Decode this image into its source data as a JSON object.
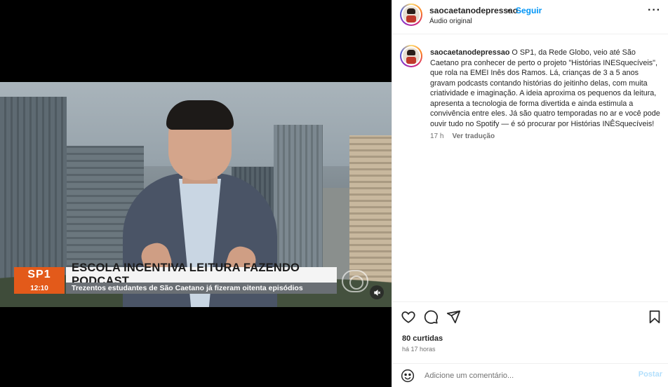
{
  "post": {
    "username": "saocaetanodepressao",
    "follow_label": "Seguir",
    "separator": "•",
    "audio_label": "Áudio original",
    "more_label": "···"
  },
  "video": {
    "logo_top": "SP1",
    "logo_time": "12:10",
    "headline": "ESCOLA INCENTIVA LEITURA FAZENDO PODCAST",
    "subline": "Trezentos estudantes de São Caetano já fizeram oitenta episódios",
    "mute_icon": "speaker-muted-icon"
  },
  "caption": {
    "username": "saocaetanodepressao",
    "text": "O SP1, da Rede Globo, veio até São Caetano pra conhecer de perto o projeto \"Histórias INESquecíveis\", que rola na EMEI Inês dos Ramos. Lá, crianças de 3 a 5 anos gravam podcasts contando histórias do jeitinho delas, com muita criatividade e imaginação. A ideia aproxima os pequenos da leitura, apresenta a tecnologia de forma divertida e ainda estimula a convivência entre eles. Já são quatro temporadas no ar e você pode ouvir tudo no Spotify — é só procurar por Histórias INÊSquecíveis!",
    "age": "17 h",
    "translate_label": "Ver tradução"
  },
  "actions": {
    "icons": [
      "heart-icon",
      "comment-icon",
      "share-icon",
      "bookmark-icon"
    ]
  },
  "stats": {
    "likes": "80 curtidas",
    "posted": "há 17 horas"
  },
  "comment_box": {
    "placeholder": "Adicione um comentário...",
    "post_label": "Postar"
  },
  "colors": {
    "accent": "#0095f6",
    "post_disabled": "#b2dffc",
    "secondary_text": "#737373",
    "border": "#efefef"
  }
}
